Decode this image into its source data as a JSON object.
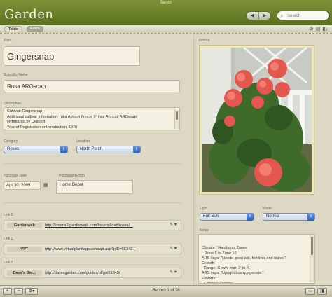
{
  "window": {
    "title": "Bento"
  },
  "header": {
    "library_title": "Garden",
    "nav_back": "◀",
    "nav_forward": "▶",
    "search_placeholder": "Search"
  },
  "tabs": {
    "table": "Table",
    "form": "Form"
  },
  "fields": {
    "plant_label": "Plant",
    "plant_value": "Gingersnap",
    "sci_label": "Scientific Name",
    "sci_value": "Rosa AROsnap",
    "desc_label": "Description",
    "desc_lines": [
      "Cultivar: Gingersnap",
      "Additional cultivar information: (aka Apricot Prince, Prince Abricot, AROsnap)",
      "Hybridized by Delbard.",
      "Year of Registration or Introduction: 1978"
    ],
    "category_label": "Category",
    "category_value": "Roses",
    "location_label": "Location",
    "location_value": "North Porch",
    "purchase_date_label": "Purchase Date",
    "purchase_date_value": "Apr 30, 2009",
    "purchased_from_label": "Purchased From",
    "purchased_from_value": "Home Depot",
    "picture_label": "Picture",
    "light_label": "Light",
    "light_value": "Full Sun",
    "water_label": "Water",
    "water_value": "Normal",
    "notes_label": "Notes",
    "notes_value": "Climate / Hardiness Zones\n   Zone 5 to Zone 10\nARS says: \"Needs good soil, fertilizer and water.\"\nGrowth:\n  Range: Grows from 3' to 4'.\nARS says: \"Upright,bushy,vigerous.\"\nFlowers:\n  Color(s): Orange"
  },
  "links": [
    {
      "label": "Link 1",
      "title": "Gardenweb",
      "url": "http://forums2.gardenweb.com/forums/load/roses/..."
    },
    {
      "label": "Link 2",
      "title": "VPT",
      "url": "http://www.virtualplanttags.com/vpt.asp?pID=55342..."
    },
    {
      "label": "Link 3",
      "title": "Dave's Gar...",
      "url": "http://davesgarden.com/guides/pf/go/61345/"
    }
  ],
  "footer": {
    "add": "+",
    "remove": "−",
    "action": "⚙▾",
    "record_status": "Record 1 of 26"
  },
  "colors": {
    "titlebar": "#6b8129",
    "accent_popup": "#3f70c8",
    "rose": "#e4574f"
  }
}
